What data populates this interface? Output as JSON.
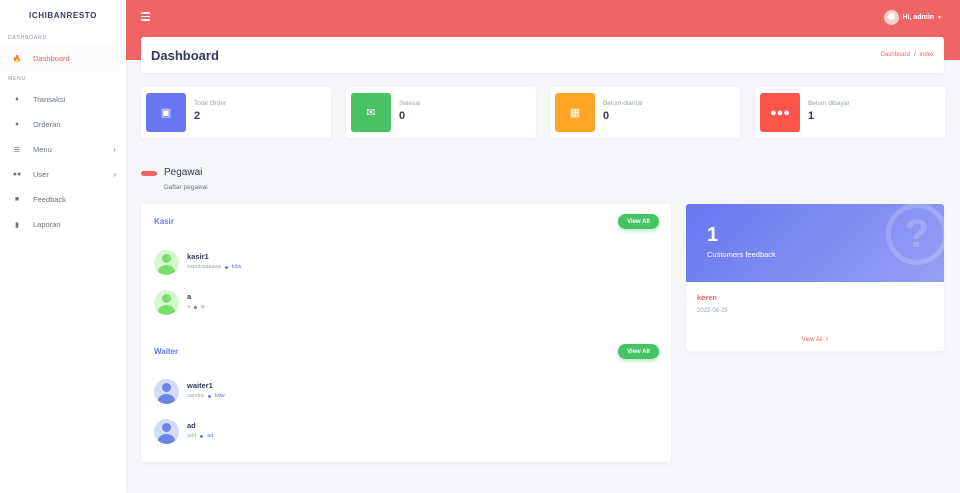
{
  "brand": "ICHIBANRESTO",
  "sidebar": {
    "header_dashboard": "DASHBOARD",
    "header_menu": "MENU",
    "items": [
      {
        "label": "Dashboard"
      },
      {
        "label": "Transaksi"
      },
      {
        "label": "Orderan"
      },
      {
        "label": "Menu"
      },
      {
        "label": "User"
      },
      {
        "label": "Feedback"
      },
      {
        "label": "Laporan"
      }
    ]
  },
  "topbar": {
    "greeting": "Hi, admin"
  },
  "page": {
    "title": "Dashboard",
    "breadcrumb": [
      "Dashboard",
      "/",
      "index"
    ]
  },
  "stats": [
    {
      "label": "Total Order",
      "value": "2",
      "color": "#6777ef"
    },
    {
      "label": "Selesai",
      "value": "0",
      "color": "#47c363"
    },
    {
      "label": "Belum diantar",
      "value": "0",
      "color": "#ffa426"
    },
    {
      "label": "Belum dibayar",
      "value": "1",
      "color": "#fc544b"
    }
  ],
  "pegawai": {
    "title": "Pegawai",
    "subtitle": "Daftar pegawai",
    "groups": [
      {
        "title": "Kasir",
        "view_all": "View All",
        "people": [
          {
            "name": "kasir1",
            "email": "saputraaaaaa",
            "loc": "kdw"
          },
          {
            "name": "a",
            "email": "a",
            "loc": "a"
          }
        ]
      },
      {
        "title": "Waiter",
        "view_all": "View All",
        "people": [
          {
            "name": "waiter1",
            "email": "candra",
            "loc": "kdw"
          },
          {
            "name": "ad",
            "email": "add",
            "loc": "ad"
          }
        ]
      }
    ]
  },
  "feedback": {
    "count": "1",
    "label": "Customers feedback",
    "latest_title": "keren",
    "latest_date": "2022-08-25",
    "view_all": "View All"
  },
  "icons": {
    "dashboard": "fire-icon",
    "transaksi": "tag-icon",
    "orderan": "tag-icon",
    "menu": "list-icon",
    "user": "users-icon",
    "feedback": "briefcase-icon",
    "laporan": "file-icon"
  }
}
